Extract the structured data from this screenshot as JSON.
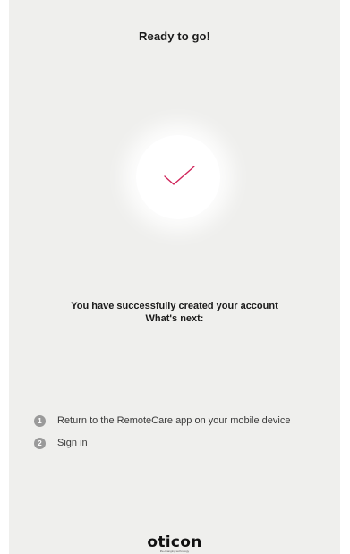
{
  "header": {
    "title": "Ready to go!"
  },
  "status": {
    "icon": "checkmark-icon",
    "accent_color": "#d0245a"
  },
  "message": {
    "line1": "You have successfully created your account",
    "line2": "What's next:"
  },
  "steps": [
    {
      "number": "1",
      "text": "Return to the RemoteCare app on your mobile device"
    },
    {
      "number": "2",
      "text": "Sign in"
    }
  ],
  "footer": {
    "logo": "oticon",
    "tagline": "life-changing technology"
  }
}
